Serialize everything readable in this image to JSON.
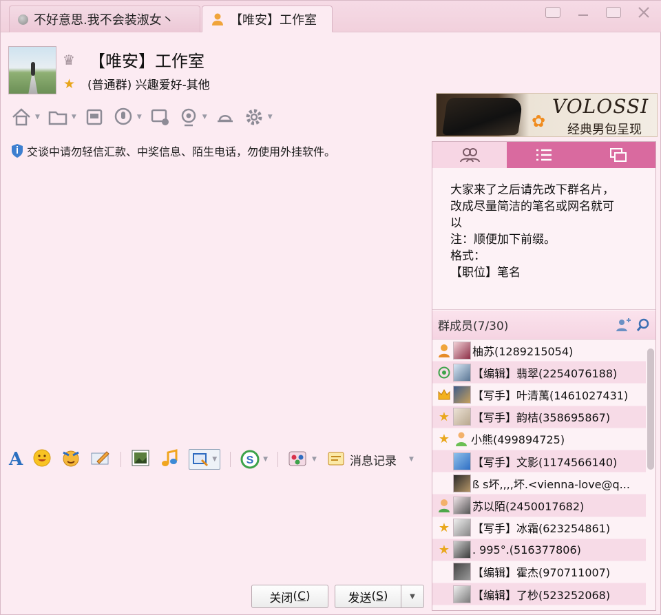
{
  "tabs": [
    {
      "label": "不好意思.我不会装淑女丶",
      "active": false
    },
    {
      "label": "【唯安】工作室",
      "active": true
    }
  ],
  "header": {
    "title": "【唯安】工作室",
    "subtitle": "(普通群) 兴趣爱好-其他"
  },
  "ad": {
    "brand": "VOLOSSI",
    "slogan": "经典男包呈现"
  },
  "notice": "交谈中请勿轻信汇款、中奖信息、陌生电话，勿使用外挂软件。",
  "announcement": "大家来了之后请先改下群名片，\n改成尽量简洁的笔名或网名就可\n以\n注：顺便加下前缀。\n格式：\n【职位】笔名",
  "members_header": "群成员(7/30)",
  "members": [
    {
      "name": "柚苏(1289215054)",
      "role": "owner"
    },
    {
      "name": "【编辑】翡翠(2254076188)",
      "role": "chat"
    },
    {
      "name": "【写手】叶清萬(1461027431)",
      "role": "crown"
    },
    {
      "name": "【写手】韵桔(358695867)",
      "role": "star"
    },
    {
      "name": "小熊(499894725)",
      "role": "star"
    },
    {
      "name": "【写手】文影(1174566140)",
      "role": "none"
    },
    {
      "name": "ß  s坏,,,,坏.<vienna-love@q...",
      "role": "none"
    },
    {
      "name": "苏以陌(2450017682)",
      "role": "person"
    },
    {
      "name": "【写手】冰霜(623254861)",
      "role": "star"
    },
    {
      "name": ".     995°.(516377806)",
      "role": "star"
    },
    {
      "name": "【编辑】霍杰(970711007)",
      "role": "none"
    },
    {
      "name": "【编辑】了杪(523252068)",
      "role": "none"
    }
  ],
  "input_toolbar": {
    "history_label": "消息记录"
  },
  "buttons": {
    "close": "关闭",
    "close_key": "C",
    "send": "发送",
    "send_key": "S"
  },
  "colors": {
    "accent": "#d96a9f",
    "background": "#fcebf2"
  }
}
